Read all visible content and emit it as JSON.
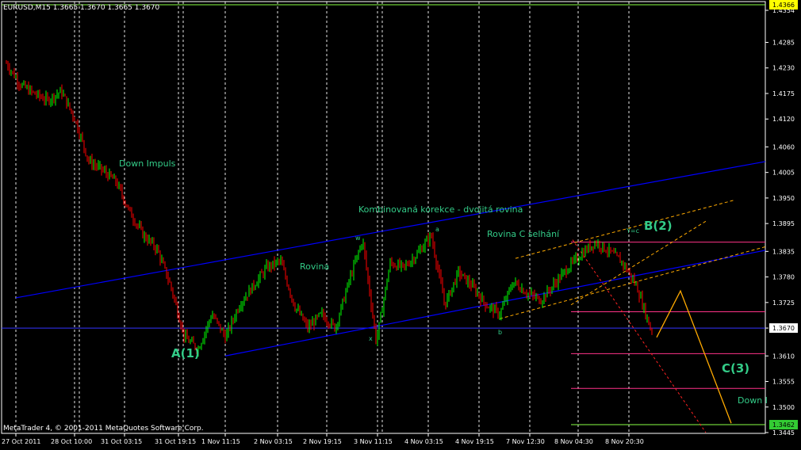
{
  "chart_data": {
    "type": "candlestick",
    "title": "EURUSD,M15  1.3665 1.3670 1.3665 1.3670",
    "footer": "MetaTrader 4, © 2001-2011 MetaQuotes Software Corp.",
    "ylim": [
      1.3445,
      1.4366
    ],
    "y_ticks": [
      "1.4354",
      "1.4285",
      "1.4230",
      "1.4175",
      "1.4120",
      "1.4060",
      "1.4005",
      "1.3950",
      "1.3895",
      "1.3835",
      "1.3780",
      "1.3725",
      "1.3670",
      "1.3610",
      "1.3555",
      "1.3500",
      "1.3445"
    ],
    "x_ticks": [
      "27 Oct 2011",
      "28 Oct 10:00",
      "31 Oct 03:15",
      "31 Oct 19:15",
      "1 Nov 11:15",
      "2 Nov 03:15",
      "2 Nov 19:15",
      "3 Nov 11:15",
      "4 Nov 03:15",
      "4 Nov 19:15",
      "7 Nov 12:30",
      "8 Nov 04:30",
      "8 Nov 20:30"
    ],
    "price_labels": {
      "top": "1.4366",
      "current": "1.3670",
      "bottom": "1.3462"
    },
    "grid": true,
    "colors": {
      "background": "#000000",
      "bull": "#00ff00",
      "bear": "#ff0000",
      "grid": "#ffffff",
      "channel": "#0000ff",
      "fib": "#ff3388",
      "projection": "#ffaa00",
      "label": "#33cc88"
    },
    "annotations": [
      {
        "text": "Down Impuls",
        "x": "31 Oct 03:15",
        "y": 1.4035
      },
      {
        "text": "Kombinovaná korekce - dvojitá rovina",
        "x": "3 Nov 11:15",
        "y": 1.3928
      },
      {
        "text": "Rovina C selhání",
        "x": "4 Nov 19:15",
        "y": 1.3865
      },
      {
        "text": "Rovina",
        "x": "2 Nov 03:15",
        "y": 1.3815
      },
      {
        "text": "w",
        "x": "3 Nov 11:15",
        "y": 1.387
      },
      {
        "text": "a",
        "x": "4 Nov 03:15",
        "y": 1.388
      },
      {
        "text": "x",
        "x": "3 Nov 11:15",
        "y": 1.364
      },
      {
        "text": "b",
        "x": "4 Nov 19:15",
        "y": 1.3662
      },
      {
        "text": "Y=c",
        "x": "8 Nov 20:30",
        "y": 1.3875
      },
      {
        "text": "A(1)",
        "x": "1 Nov 11:15",
        "y": 1.361
      },
      {
        "text": "B(2)",
        "x": "8 Nov 20:30",
        "y": 1.388
      },
      {
        "text": "C(3)",
        "x": "8 Nov 20:30",
        "y": 1.357
      },
      {
        "text": "Down I",
        "x": "8 Nov 20:30",
        "y": 1.35
      }
    ],
    "fib_levels": [
      1.3855,
      1.3705,
      1.3615,
      1.354,
      1.3462
    ],
    "channel_lines": [
      {
        "from": [
          "27 Oct 2011",
          1.3735
        ],
        "to": [
          "8 Nov 20:30",
          1.3975
        ]
      },
      {
        "from": [
          "1 Nov 11:15",
          1.361
        ],
        "to": [
          "8 Nov 20:30",
          1.378
        ]
      }
    ],
    "price_path": [
      [
        "27 Oct 2011",
        1.424
      ],
      [
        "27 Oct 2011",
        1.4195
      ],
      [
        "28 Oct 10:00",
        1.4175
      ],
      [
        "28 Oct 10:00",
        1.416
      ],
      [
        "28 Oct 10:00",
        1.418
      ],
      [
        "28 Oct 10:00",
        1.412
      ],
      [
        "31 Oct 03:15",
        1.403
      ],
      [
        "31 Oct 03:15",
        1.401
      ],
      [
        "31 Oct 03:15",
        1.3985
      ],
      [
        "31 Oct 03:15",
        1.392
      ],
      [
        "31 Oct 19:15",
        1.387
      ],
      [
        "31 Oct 19:15",
        1.384
      ],
      [
        "31 Oct 19:15",
        1.376
      ],
      [
        "1 Nov 11:15",
        1.365
      ],
      [
        "1 Nov 11:15",
        1.3625
      ],
      [
        "1 Nov 11:15",
        1.37
      ],
      [
        "2 Nov 03:15",
        1.365
      ],
      [
        "2 Nov 03:15",
        1.372
      ],
      [
        "2 Nov 03:15",
        1.376
      ],
      [
        "2 Nov 03:15",
        1.38
      ],
      [
        "2 Nov 19:15",
        1.3815
      ],
      [
        "2 Nov 19:15",
        1.372
      ],
      [
        "2 Nov 19:15",
        1.367
      ],
      [
        "2 Nov 19:15",
        1.37
      ],
      [
        "3 Nov 11:15",
        1.367
      ],
      [
        "3 Nov 11:15",
        1.377
      ],
      [
        "3 Nov 11:15",
        1.386
      ],
      [
        "3 Nov 11:15",
        1.364
      ],
      [
        "3 Nov 11:15",
        1.381
      ],
      [
        "4 Nov 03:15",
        1.38
      ],
      [
        "4 Nov 03:15",
        1.383
      ],
      [
        "4 Nov 03:15",
        1.387
      ],
      [
        "4 Nov 03:15",
        1.372
      ],
      [
        "4 Nov 19:15",
        1.379
      ],
      [
        "4 Nov 19:15",
        1.376
      ],
      [
        "4 Nov 19:15",
        1.372
      ],
      [
        "4 Nov 19:15",
        1.37
      ],
      [
        "7 Nov 12:30",
        1.377
      ],
      [
        "7 Nov 12:30",
        1.3745
      ],
      [
        "7 Nov 12:30",
        1.373
      ],
      [
        "8 Nov 04:30",
        1.3765
      ],
      [
        "8 Nov 04:30",
        1.38
      ],
      [
        "8 Nov 04:30",
        1.383
      ],
      [
        "8 Nov 20:30",
        1.3855
      ],
      [
        "8 Nov 20:30",
        1.3835
      ],
      [
        "8 Nov 20:30",
        1.381
      ],
      [
        "8 Nov 20:30",
        1.376
      ],
      [
        "8 Nov 20:30",
        1.367
      ]
    ]
  }
}
